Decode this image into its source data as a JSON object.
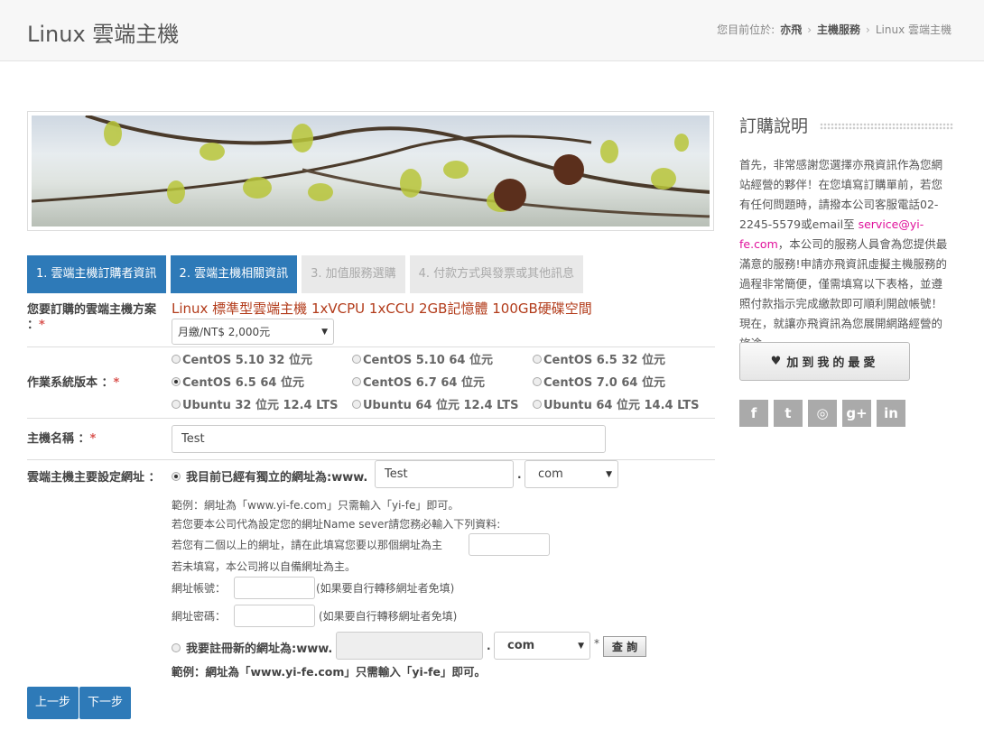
{
  "header": {
    "title": "Linux 雲端主機",
    "breadcrumb": {
      "prefix": "您目前位於:",
      "items": [
        "亦飛",
        "主機服務",
        "Linux 雲端主機"
      ]
    }
  },
  "tabs": [
    {
      "label": "1. 雲端主機訂購者資訊",
      "active": true
    },
    {
      "label": "2. 雲端主機相關資訊",
      "active": true
    },
    {
      "label": "3. 加值服務選購",
      "active": false
    },
    {
      "label": "4. 付款方式與發票或其他訊息",
      "active": false
    }
  ],
  "plan": {
    "label": "您要訂購的雲端主機方案",
    "label_suffix": "：",
    "required": "*",
    "name": "Linux 標準型雲端主機 1xVCPU 1xCCU 2GB記憶體 100GB硬碟空間",
    "billing_value": "月繳/NT$ 2,000元"
  },
  "os": {
    "label": "作業系統版本 ：",
    "required": "*",
    "options": [
      "CentOS 5.10 32 位元",
      "CentOS 5.10 64 位元",
      "CentOS 6.5 32 位元",
      "CentOS 6.5 64 位元",
      "CentOS 6.7 64 位元",
      "CentOS 7.0 64 位元",
      "Ubuntu 32 位元 12.4 LTS",
      "Ubuntu 64 位元 12.4 LTS",
      "Ubuntu 64 位元 14.4 LTS"
    ],
    "selected_index": 3
  },
  "hostname": {
    "label": "主機名稱 ：",
    "required": "*",
    "value": "Test"
  },
  "domain": {
    "label": "雲端主機主要設定網址 ：",
    "own_label": "我目前已經有獨立的網址為:www.",
    "own_value": "Test",
    "dot": ".",
    "tld_value": "com",
    "example": "範例：網址為「www.yi-fe.com」只需輸入「yi-fe」即可。",
    "ns_note": "若您要本公司代為設定您的網址Name sever請您務必輸入下列資料:",
    "multi_note": "若您有二個以上的網址，請在此填寫您要以那個網址為主",
    "default_note": "若未填寫，本公司將以自備網址為主。",
    "account_label": "網址帳號：",
    "account_hint": "(如果要自行轉移網址者免填)",
    "password_label": "網址密碼：",
    "password_hint": "(如果要自行轉移網址者免填)",
    "new_label": "我要註冊新的網址為:www.",
    "new_tld_value": "com",
    "new_required": "*",
    "query_button": "查 詢",
    "new_example": "範例：網址為「www.yi-fe.com」只需輸入「yi-fe」即可。"
  },
  "nav": {
    "prev": "上一步",
    "next": "下一步"
  },
  "sidebar": {
    "title": "訂購說明",
    "text_before": "首先，非常感謝您選擇亦飛資訊作為您網站經營的夥伴！在您填寫訂購單前，若您有任何問題時，請撥本公司客服電話02-2245-5579或email至 ",
    "email": "service@yi-fe.com",
    "text_after": "，本公司的服務人員會為您提供最滿意的服務!申請亦飛資訊虛擬主機服務的過程非常簡便，僅需填寫以下表格，並遵照付款指示完成繳款即可順利開啟帳號！現在，就讓亦飛資訊為您展開網路經營的旅途。",
    "fav_button": "加到我的最愛",
    "social": [
      {
        "icon": "facebook-icon",
        "glyph": "f"
      },
      {
        "icon": "twitter-icon",
        "glyph": "t"
      },
      {
        "icon": "dribbble-icon",
        "glyph": "◎"
      },
      {
        "icon": "google-plus-icon",
        "glyph": "g+"
      },
      {
        "icon": "linkedin-icon",
        "glyph": "in"
      }
    ]
  },
  "colors": {
    "accent": "#2e7ab8",
    "plan_text": "#b23b1a",
    "email": "#e0119b",
    "required": "#d9534f"
  }
}
